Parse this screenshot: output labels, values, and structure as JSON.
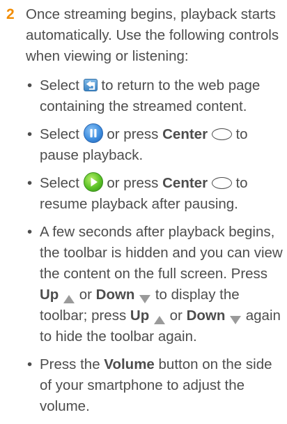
{
  "step": {
    "number": "2",
    "text": "Once streaming begins, playback starts automatically. Use the following controls when viewing or listening:"
  },
  "bullets": [
    {
      "before": "Select ",
      "icon": "back-arrow-icon",
      "after": " to return to the web page containing the streamed content."
    },
    {
      "before": "Select ",
      "icon": "pause-icon",
      "mid": " or press ",
      "key": "Center",
      "key_icon": "center-key-icon",
      "after": " to pause playback."
    },
    {
      "before": "Select ",
      "icon": "play-icon",
      "mid": " or press ",
      "key": "Center",
      "key_icon": "center-key-icon",
      "after": " to resume playback after pausing."
    },
    {
      "text1": "A few seconds after playback begins, the toolbar is hidden and you can view the content on the full screen. Press ",
      "up": "Up",
      "or1": " or ",
      "down": "Down",
      "text2": " to display the toolbar; press ",
      "up2": "Up",
      "or2": " or ",
      "down2": "Down",
      "text3": " again to hide the toolbar again."
    },
    {
      "text1": "Press the ",
      "key": "Volume",
      "text2": " button on the side of your smartphone to adjust the volume."
    }
  ],
  "bullet_char": "•",
  "colors": {
    "step_number": "#f28c00",
    "body_text": "#4d4d4d",
    "arrow_gray": "#9a9a9a"
  }
}
